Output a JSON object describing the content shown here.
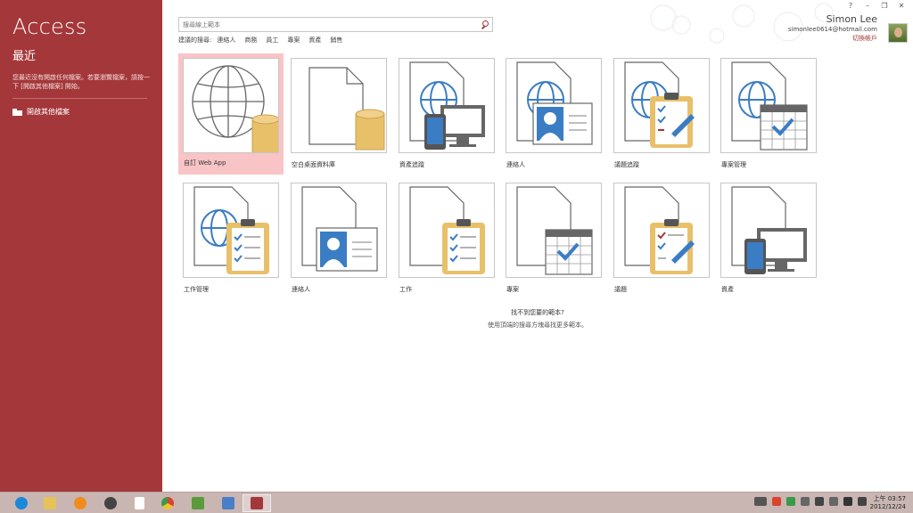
{
  "left": {
    "app_title": "Access",
    "recent_title": "最近",
    "recent_message": "您最近沒有開啟任何檔案。若要瀏覽檔案，請按一下 [開啟其他檔案] 開始。",
    "open_other_label": "開啟其他檔案"
  },
  "search": {
    "placeholder": "搜尋線上範本",
    "suggested_label": "建議的搜尋:",
    "suggested": [
      "連絡人",
      "商務",
      "員工",
      "專案",
      "資產",
      "銷售"
    ]
  },
  "window_controls": [
    "?",
    "–",
    "❐",
    "✕"
  ],
  "user": {
    "name": "Simon Lee",
    "email": "simonlee0614@hotmail.com",
    "switch_label": "切換帳戶"
  },
  "templates": [
    {
      "label": "自訂 Web App",
      "icon": "web-app-icon"
    },
    {
      "label": "空白桌面資料庫",
      "icon": "blank-database-icon"
    },
    {
      "label": "資產追蹤",
      "icon": "asset-tracking-icon"
    },
    {
      "label": "連絡人",
      "icon": "contacts-web-icon"
    },
    {
      "label": "議題追蹤",
      "icon": "issue-tracking-icon"
    },
    {
      "label": "專案管理",
      "icon": "project-management-icon"
    },
    {
      "label": "工作管理",
      "icon": "task-management-icon"
    },
    {
      "label": "連絡人",
      "icon": "contacts-icon"
    },
    {
      "label": "工作",
      "icon": "tasks-icon"
    },
    {
      "label": "專案",
      "icon": "projects-icon"
    },
    {
      "label": "議題",
      "icon": "issues-icon"
    },
    {
      "label": "資產",
      "icon": "assets-icon"
    }
  ],
  "not_found": {
    "line1": "找不到您要的範本?",
    "line2": "使用頂端的搜尋方塊尋找更多範本。"
  },
  "taskbar": {
    "apps": [
      {
        "icon": "ie-icon",
        "color": "#1e88d8"
      },
      {
        "icon": "file-explorer-icon",
        "color": "#e6c25a"
      },
      {
        "icon": "media-player-icon",
        "color": "#f08c1e"
      },
      {
        "icon": "home-app-icon",
        "color": "#444444"
      },
      {
        "icon": "document-icon",
        "color": "#ffffff"
      },
      {
        "icon": "chrome-icon",
        "color": "#d9442f"
      },
      {
        "icon": "network-app-icon",
        "color": "#5b9a3a"
      },
      {
        "icon": "pen-app-icon",
        "color": "#4a7ec8"
      },
      {
        "icon": "access-app-icon",
        "color": "#a4373a"
      }
    ],
    "time": "上午 03:57",
    "date": "2012/12/24"
  },
  "colors": {
    "accent": "#a4373a",
    "db_gold": "#e8c06a",
    "icon_blue": "#3b7dc4",
    "icon_gray": "#666666"
  }
}
